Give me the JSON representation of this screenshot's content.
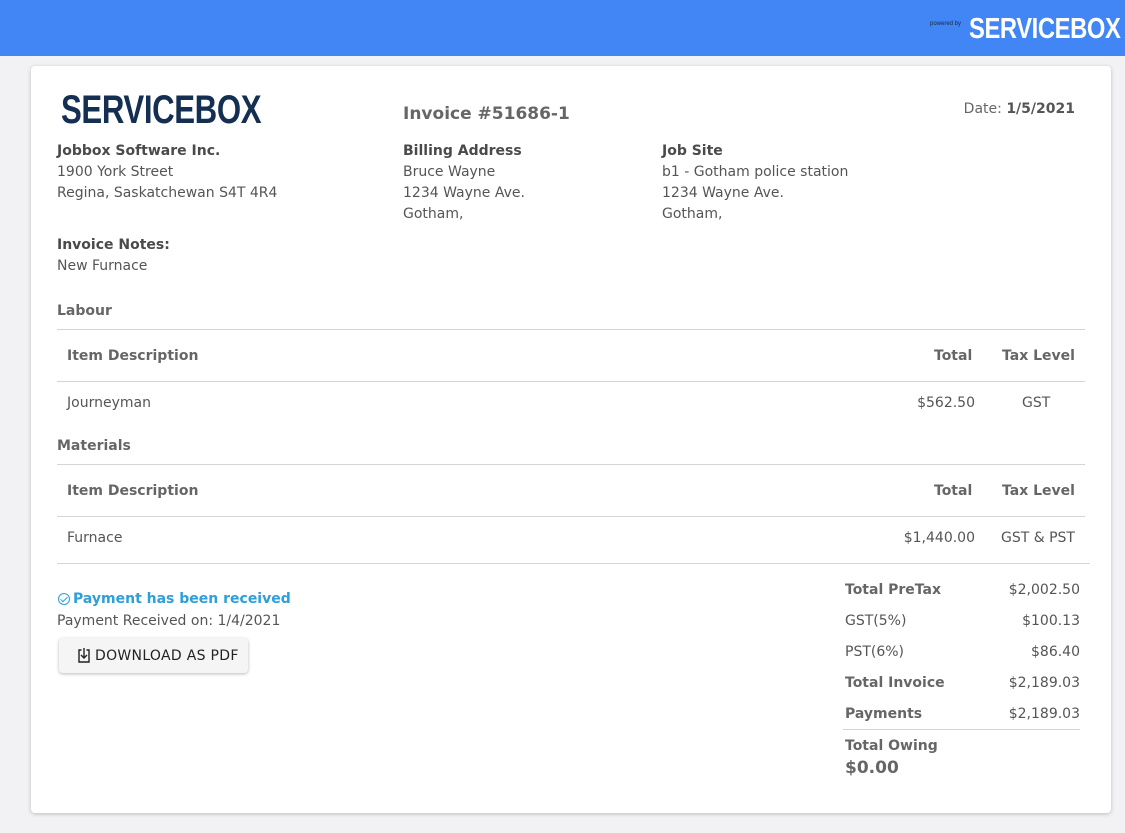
{
  "topbar": {
    "powered_by": "powered by",
    "logo_text": "SERVICEBOX"
  },
  "company": {
    "logo_text": "SERVICEBOX",
    "name": "Jobbox Software Inc.",
    "address1": "1900 York Street",
    "address2": "Regina, Saskatchewan S4T 4R4"
  },
  "invoice": {
    "title": "Invoice #51686-1",
    "date_label": "Date:",
    "date_value": "1/5/2021"
  },
  "billing": {
    "heading": "Billing Address",
    "name": "Bruce Wayne",
    "street": "1234 Wayne Ave.",
    "city": "Gotham,"
  },
  "job_site": {
    "heading": "Job Site",
    "name": "b1 - Gotham police station",
    "street": "1234 Wayne Ave.",
    "city": "Gotham,"
  },
  "notes": {
    "heading": "Invoice Notes:",
    "text": "New Furnace"
  },
  "labour": {
    "title": "Labour",
    "headers": {
      "description": "Item Description",
      "total": "Total",
      "tax": "Tax Level"
    },
    "rows": [
      {
        "description": "Journeyman",
        "total": "$562.50",
        "tax": "GST"
      }
    ]
  },
  "materials": {
    "title": "Materials",
    "headers": {
      "description": "Item Description",
      "total": "Total",
      "tax": "Tax Level"
    },
    "rows": [
      {
        "description": "Furnace",
        "total": "$1,440.00",
        "tax": "GST & PST"
      }
    ]
  },
  "payment": {
    "status": "Payment has been received",
    "received_on": "Payment Received on: 1/4/2021",
    "status_color": "#2d9fd9",
    "download_label": "DOWNLOAD AS PDF"
  },
  "summary": {
    "pretax_label": "Total PreTax",
    "pretax_value": "$2,002.50",
    "gst_label": "GST(5%)",
    "gst_value": "$100.13",
    "pst_label": "PST(6%)",
    "pst_value": "$86.40",
    "total_label": "Total Invoice",
    "total_value": "$2,189.03",
    "payments_label": "Payments",
    "payments_value": "$2,189.03",
    "owing_label": "Total Owing",
    "owing_value": "$0.00"
  },
  "colors": {
    "topbar": "#4285f4",
    "brand": "#142f52",
    "accent": "#2d9fd9"
  }
}
